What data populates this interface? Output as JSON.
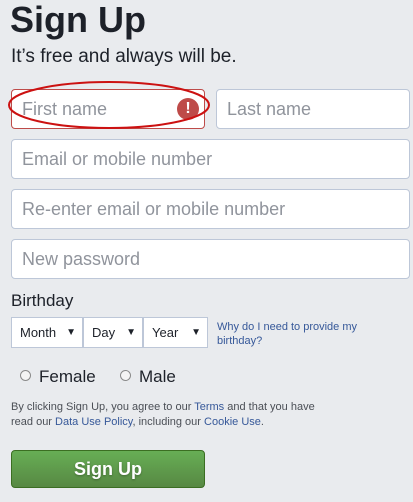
{
  "form": {
    "title": "Sign Up",
    "subtitle": "It’s free and always will be.",
    "fields": {
      "first_name": {
        "placeholder": "First name",
        "value": "",
        "error": true
      },
      "last_name": {
        "placeholder": "Last name",
        "value": ""
      },
      "email": {
        "placeholder": "Email or mobile number",
        "value": ""
      },
      "email_confirm": {
        "placeholder": "Re-enter email or mobile number",
        "value": ""
      },
      "password": {
        "placeholder": "New password",
        "value": ""
      }
    },
    "error_icon": {
      "name": "exclamation-icon",
      "glyph": "!"
    },
    "birthday": {
      "label": "Birthday",
      "month": "Month",
      "day": "Day",
      "year": "Year",
      "arrow_glyph": "▼",
      "help_link": "Why do I need to provide my birthday?"
    },
    "gender": {
      "female": "Female",
      "male": "Male",
      "selected": null
    },
    "terms": {
      "prefix": "By clicking Sign Up, you agree to our ",
      "terms_link": "Terms",
      "middle1": " and that you have read our ",
      "data_policy_link": "Data Use Policy",
      "middle2": ", including our ",
      "cookie_link": "Cookie Use",
      "suffix": "."
    },
    "submit_label": "Sign Up"
  },
  "colors": {
    "background": "#e9ebee",
    "error": "#be4b49",
    "link": "#365899",
    "button_green": "#67ae55",
    "annotation_red": "#cc1111"
  }
}
